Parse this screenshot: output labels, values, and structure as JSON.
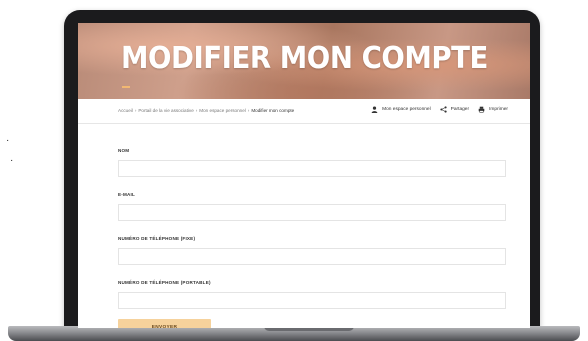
{
  "hero": {
    "title": "MODIFIER MON COMPTE"
  },
  "breadcrumb": {
    "items": [
      "Accueil",
      "Portail de la vie associative",
      "Mon espace personnel"
    ],
    "current": "Modifier mon compte",
    "separator": "›"
  },
  "toolbar": {
    "account_label": "Mon espace personnel",
    "share_label": "Partager",
    "print_label": "Imprimer"
  },
  "form": {
    "fields": [
      {
        "label": "NOM",
        "value": ""
      },
      {
        "label": "E-MAIL",
        "value": ""
      },
      {
        "label": "NUMÉRO DE TÉLÉPHONE (FIXE)",
        "value": ""
      },
      {
        "label": "NUMÉRO DE TÉLÉPHONE (PORTABLE)",
        "value": ""
      }
    ],
    "submit_label": "ENVOYER"
  },
  "colors": {
    "accent": "#f6d29c",
    "accent_text": "#6b4a1f",
    "hero_dash": "#f2b872",
    "laptop_frame": "#1b1b1d"
  }
}
